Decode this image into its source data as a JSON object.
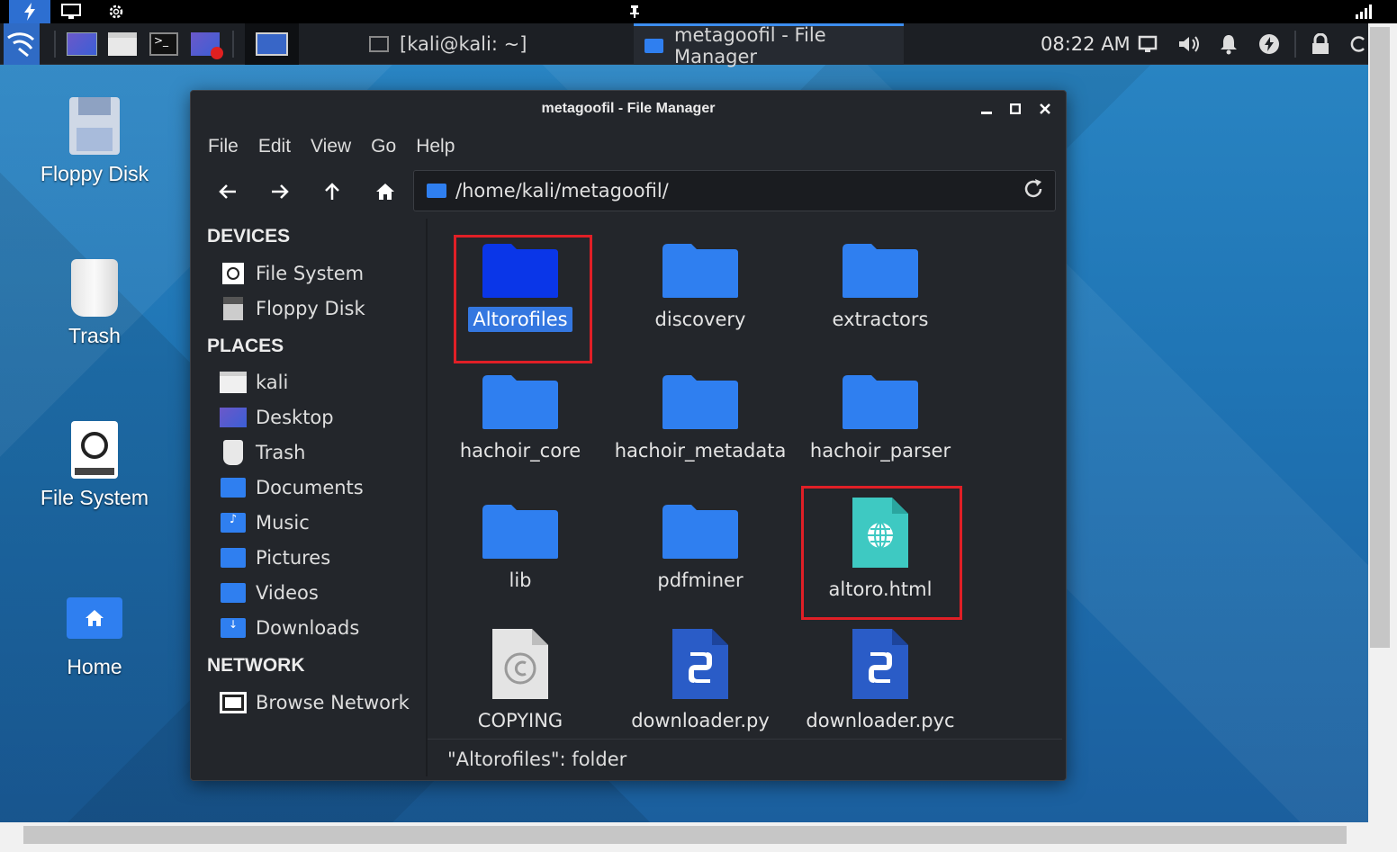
{
  "panel": {
    "tasks": [
      {
        "label": "[kali@kali: ~]"
      },
      {
        "label": "metagoofil - File Manager"
      }
    ],
    "clock": "08:22 AM"
  },
  "desktop": {
    "icons": [
      {
        "label": "Floppy Disk"
      },
      {
        "label": "Trash"
      },
      {
        "label": "File System"
      },
      {
        "label": "Home"
      }
    ]
  },
  "window": {
    "title": "metagoofil - File Manager",
    "menus": [
      "File",
      "Edit",
      "View",
      "Go",
      "Help"
    ],
    "path": "/home/kali/metagoofil/",
    "sidebar": {
      "devices_header": "DEVICES",
      "devices": [
        {
          "label": "File System",
          "icon": "harddisk-icon"
        },
        {
          "label": "Floppy Disk",
          "icon": "floppy-icon"
        }
      ],
      "places_header": "PLACES",
      "places": [
        {
          "label": "kali",
          "icon": "home-folder-icon"
        },
        {
          "label": "Desktop",
          "icon": "desktop-icon"
        },
        {
          "label": "Trash",
          "icon": "trash-icon"
        },
        {
          "label": "Documents",
          "icon": "documents-folder-icon"
        },
        {
          "label": "Music",
          "icon": "music-folder-icon"
        },
        {
          "label": "Pictures",
          "icon": "pictures-folder-icon"
        },
        {
          "label": "Videos",
          "icon": "videos-folder-icon"
        },
        {
          "label": "Downloads",
          "icon": "downloads-folder-icon"
        }
      ],
      "network_header": "NETWORK",
      "network": [
        {
          "label": "Browse Network",
          "icon": "network-icon"
        }
      ]
    },
    "files": [
      {
        "name": "Altorofiles",
        "type": "folder",
        "selected": true
      },
      {
        "name": "discovery",
        "type": "folder"
      },
      {
        "name": "extractors",
        "type": "folder"
      },
      {
        "name": "hachoir_core",
        "type": "folder"
      },
      {
        "name": "hachoir_metadata",
        "type": "folder"
      },
      {
        "name": "hachoir_parser",
        "type": "folder"
      },
      {
        "name": "lib",
        "type": "folder"
      },
      {
        "name": "pdfminer",
        "type": "folder"
      },
      {
        "name": "altoro.html",
        "type": "html"
      },
      {
        "name": "COPYING",
        "type": "text"
      },
      {
        "name": "downloader.py",
        "type": "python"
      },
      {
        "name": "downloader.pyc",
        "type": "python"
      }
    ],
    "status": "\"Altorofiles\": folder"
  },
  "colors": {
    "folder": "#2f7ff0",
    "folder_selected": "#0a36e8",
    "selection": "#3477e0",
    "highlight_box": "#e01f26",
    "html_file": "#3ec9c2",
    "python_file": "#2a5cc7"
  }
}
